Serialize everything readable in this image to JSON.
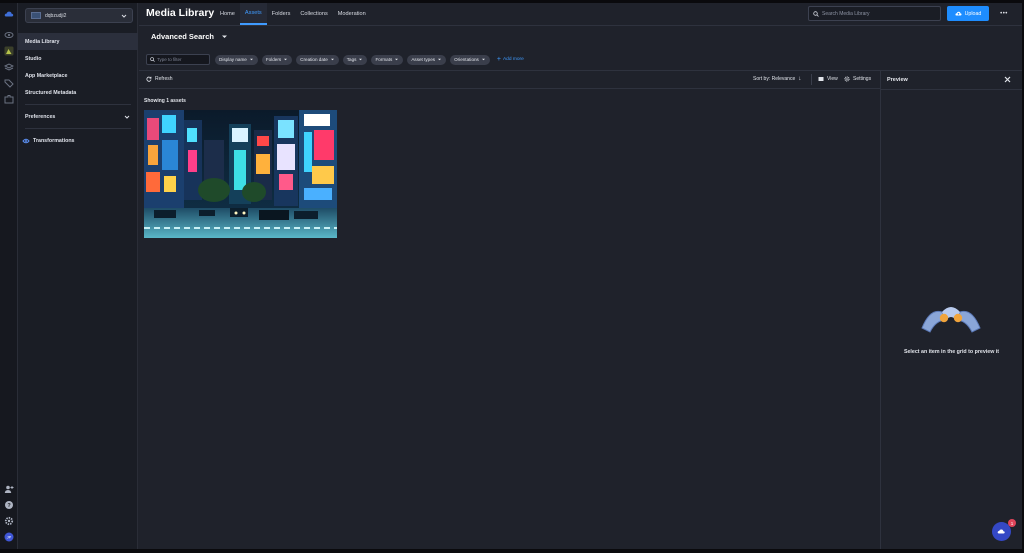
{
  "sidebar": {
    "cloud_name": "dqbzudji2",
    "items": [
      {
        "label": "Media Library"
      },
      {
        "label": "Studio"
      },
      {
        "label": "App Marketplace"
      },
      {
        "label": "Structured Metadata"
      },
      {
        "label": "Preferences"
      },
      {
        "label": "Transformations"
      }
    ]
  },
  "header": {
    "title": "Media Library",
    "tabs": [
      {
        "label": "Home"
      },
      {
        "label": "Assets"
      },
      {
        "label": "Folders"
      },
      {
        "label": "Collections"
      },
      {
        "label": "Moderation"
      }
    ],
    "active_tab": "Assets",
    "search_placeholder": "Search Media Library",
    "upload_label": "Upload",
    "more_label": "•••"
  },
  "advanced_search": {
    "title": "Advanced Search",
    "filter_placeholder": "Type to filter",
    "chips": [
      {
        "label": "Display name"
      },
      {
        "label": "Folders"
      },
      {
        "label": "Creation date"
      },
      {
        "label": "Tags"
      },
      {
        "label": "Formats"
      },
      {
        "label": "Asset types"
      },
      {
        "label": "Orientations"
      }
    ],
    "add_more_label": "Add more"
  },
  "toolbar": {
    "refresh_label": "Refresh",
    "sort_label": "Sort by: Relevance",
    "sort_arrow": "↓",
    "view_label": "View",
    "settings_label": "Settings"
  },
  "results": {
    "showing_label": "Showing 1 assets"
  },
  "preview": {
    "title": "Preview",
    "empty_text": "Select an item in the grid to preview it"
  },
  "fab": {
    "badge": "1"
  },
  "colors": {
    "accent": "#1e8dff",
    "background": "#1f222b",
    "sidebar": "#1a1d25"
  }
}
